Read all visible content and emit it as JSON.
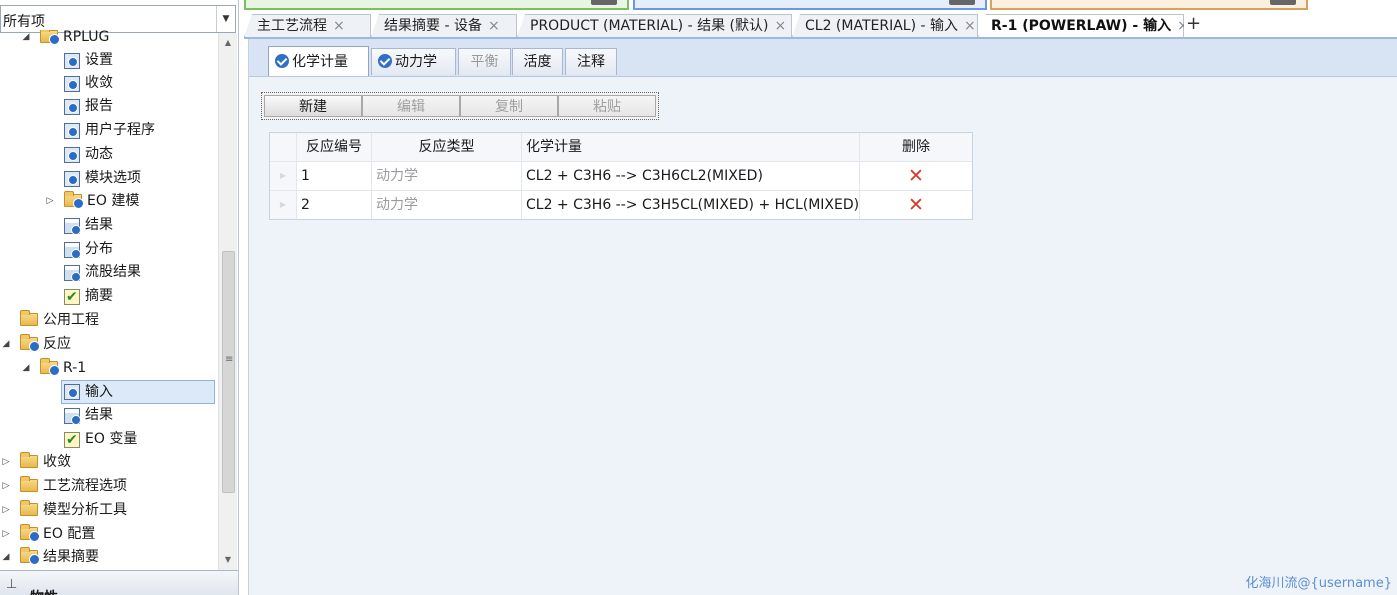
{
  "navigator": {
    "filter_value": "所有项",
    "tree": [
      {
        "label": "RPLUG",
        "icon": "folder-check-icon",
        "expanded": true
      },
      {
        "label": "设置",
        "icon": "form-icon"
      },
      {
        "label": "收敛",
        "icon": "form-icon"
      },
      {
        "label": "报告",
        "icon": "form-icon"
      },
      {
        "label": "用户子程序",
        "icon": "form-icon"
      },
      {
        "label": "动态",
        "icon": "form-icon"
      },
      {
        "label": "模块选项",
        "icon": "form-icon"
      },
      {
        "label": "EO 建模",
        "icon": "folder-check-icon",
        "expanded": false
      },
      {
        "label": "结果",
        "icon": "results-icon"
      },
      {
        "label": "分布",
        "icon": "results-icon"
      },
      {
        "label": "流股结果",
        "icon": "results-icon"
      },
      {
        "label": "摘要",
        "icon": "summary-icon"
      },
      {
        "label": "公用工程",
        "icon": "folder-icon"
      },
      {
        "label": "反应",
        "icon": "folder-check-icon",
        "expanded": true
      },
      {
        "label": "R-1",
        "icon": "folder-check-icon",
        "expanded": true
      },
      {
        "label": "输入",
        "icon": "form-icon",
        "selected": true
      },
      {
        "label": "结果",
        "icon": "results-icon"
      },
      {
        "label": "EO 变量",
        "icon": "summary-icon"
      },
      {
        "label": "收敛",
        "icon": "folder-icon",
        "expanded": false
      },
      {
        "label": "工艺流程选项",
        "icon": "folder-icon",
        "expanded": false
      },
      {
        "label": "模型分析工具",
        "icon": "folder-icon",
        "expanded": false
      },
      {
        "label": "EO 配置",
        "icon": "folder-check-icon",
        "expanded": false
      },
      {
        "label": "结果摘要",
        "icon": "folder-check-icon",
        "expanded": true
      }
    ],
    "bottom_section": "物性"
  },
  "doc_tabs": [
    {
      "label": "主工艺流程"
    },
    {
      "label": "结果摘要 - 设备"
    },
    {
      "label": "PRODUCT (MATERIAL) - 结果 (默认)"
    },
    {
      "label": "CL2 (MATERIAL) - 输入"
    },
    {
      "label": "R-1 (POWERLAW) - 输入",
      "active": true
    }
  ],
  "new_tab_glyph": "+",
  "close_glyph": "×",
  "inner_tabs": [
    {
      "label": "化学计量",
      "check": true,
      "active": true
    },
    {
      "label": "动力学",
      "check": true
    },
    {
      "label": "平衡",
      "disabled": true
    },
    {
      "label": "活度"
    },
    {
      "label": "注释"
    }
  ],
  "toolbar": {
    "new": "新建",
    "edit": "编辑",
    "copy": "复制",
    "paste": "粘贴"
  },
  "grid": {
    "headers": {
      "id": "反应编号",
      "type": "反应类型",
      "stoich": "化学计量",
      "delete": "删除"
    },
    "rows": [
      {
        "id": "1",
        "type": "动力学",
        "stoich": "CL2  + C3H6   -->  C3H6CL2(MIXED)"
      },
      {
        "id": "2",
        "type": "动力学",
        "stoich": "CL2  + C3H6   -->  C3H5CL(MIXED) + HCL(MIXED)"
      }
    ],
    "delete_glyph": "✕"
  },
  "watermark": "化海川流@{username}",
  "colors": {
    "accent_blue": "#2f6fc8",
    "delete_red": "#d83a2a",
    "bar_green": "#7cbe62",
    "bar_blue": "#6b98e0",
    "bar_orange": "#d9a15e"
  }
}
